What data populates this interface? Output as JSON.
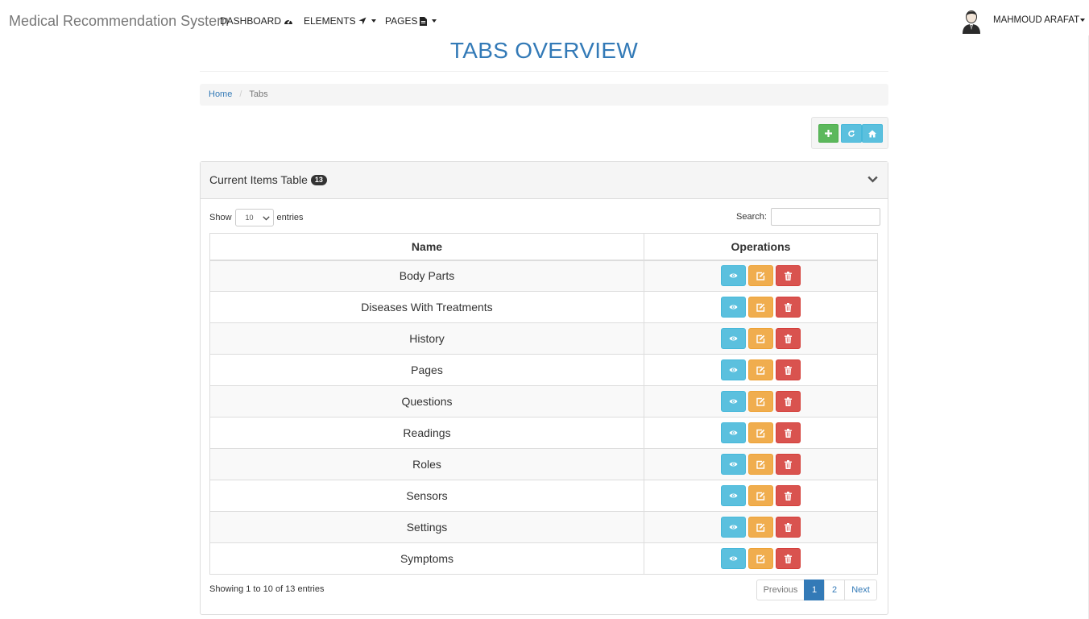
{
  "navbar": {
    "brand": "Medical Recommendation System",
    "items": [
      {
        "label": "DASHBOARD",
        "icon": "dashboard-icon"
      },
      {
        "label": "ELEMENTS",
        "icon": "location-arrow-icon"
      },
      {
        "label": "PAGES",
        "icon": "file-icon"
      }
    ],
    "user": {
      "name": "MAHMOUD ARAFAT",
      "avatar": "user-avatar-icon"
    }
  },
  "page": {
    "title": "TABS OVERVIEW",
    "breadcrumb": {
      "home": "Home",
      "current": "Tabs"
    }
  },
  "toolbar": {
    "buttons": [
      {
        "icon": "plus-icon",
        "color": "#5cb85c"
      },
      {
        "icon": "refresh-icon",
        "color": "#5bc0de"
      },
      {
        "icon": "home-icon",
        "color": "#5bc0de"
      }
    ]
  },
  "panel": {
    "title": "Current Items Table",
    "badge": "13",
    "show_label": "Show",
    "entries_label": "entries",
    "page_size": "10",
    "search_label": "Search:",
    "search_value": ""
  },
  "table": {
    "columns": [
      "Name",
      "Operations"
    ],
    "rows": [
      {
        "name": "Body Parts"
      },
      {
        "name": "Diseases With Treatments"
      },
      {
        "name": "History"
      },
      {
        "name": "Pages"
      },
      {
        "name": "Questions"
      },
      {
        "name": "Readings"
      },
      {
        "name": "Roles"
      },
      {
        "name": "Sensors"
      },
      {
        "name": "Settings"
      },
      {
        "name": "Symptoms"
      }
    ],
    "operations": [
      {
        "icon": "eye-icon",
        "color": "#5bc0de"
      },
      {
        "icon": "edit-icon",
        "color": "#f0ad4e"
      },
      {
        "icon": "trash-icon",
        "color": "#d9534f"
      }
    ]
  },
  "footer": {
    "info": "Showing 1 to 10 of 13 entries",
    "pagination": {
      "previous": "Previous",
      "pages": [
        "1",
        "2"
      ],
      "active": "1",
      "next": "Next"
    }
  }
}
